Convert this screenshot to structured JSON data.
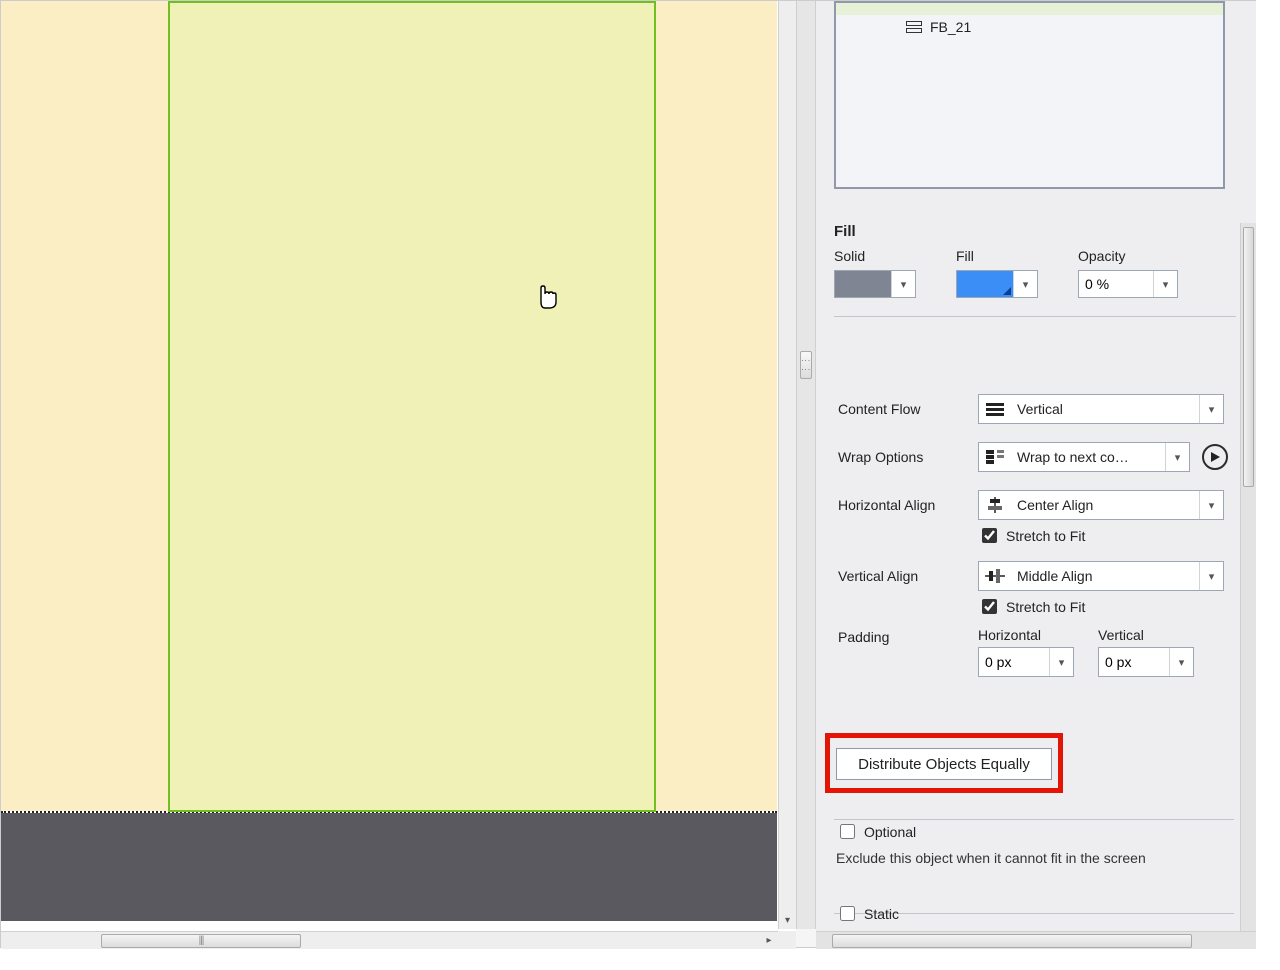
{
  "tree": {
    "item_label": "FB_21"
  },
  "fill": {
    "section_title": "Fill",
    "solid_label": "Solid",
    "fill_label": "Fill",
    "opacity_label": "Opacity",
    "opacity_value": "0 %"
  },
  "layout": {
    "content_flow_label": "Content Flow",
    "content_flow_value": "Vertical",
    "wrap_label": "Wrap Options",
    "wrap_value": "Wrap to next co…",
    "halign_label": "Horizontal Align",
    "halign_value": "Center Align",
    "halign_stretch_label": "Stretch to Fit",
    "valign_label": "Vertical Align",
    "valign_value": "Middle Align",
    "valign_stretch_label": "Stretch to Fit",
    "padding_label": "Padding",
    "padding_h_label": "Horizontal",
    "padding_h_value": "0 px",
    "padding_v_label": "Vertical",
    "padding_v_value": "0 px"
  },
  "distribute_label": "Distribute Objects Equally",
  "optional": {
    "label": "Optional",
    "hint": "Exclude this object when it cannot fit in the screen"
  },
  "static": {
    "label": "Static"
  }
}
